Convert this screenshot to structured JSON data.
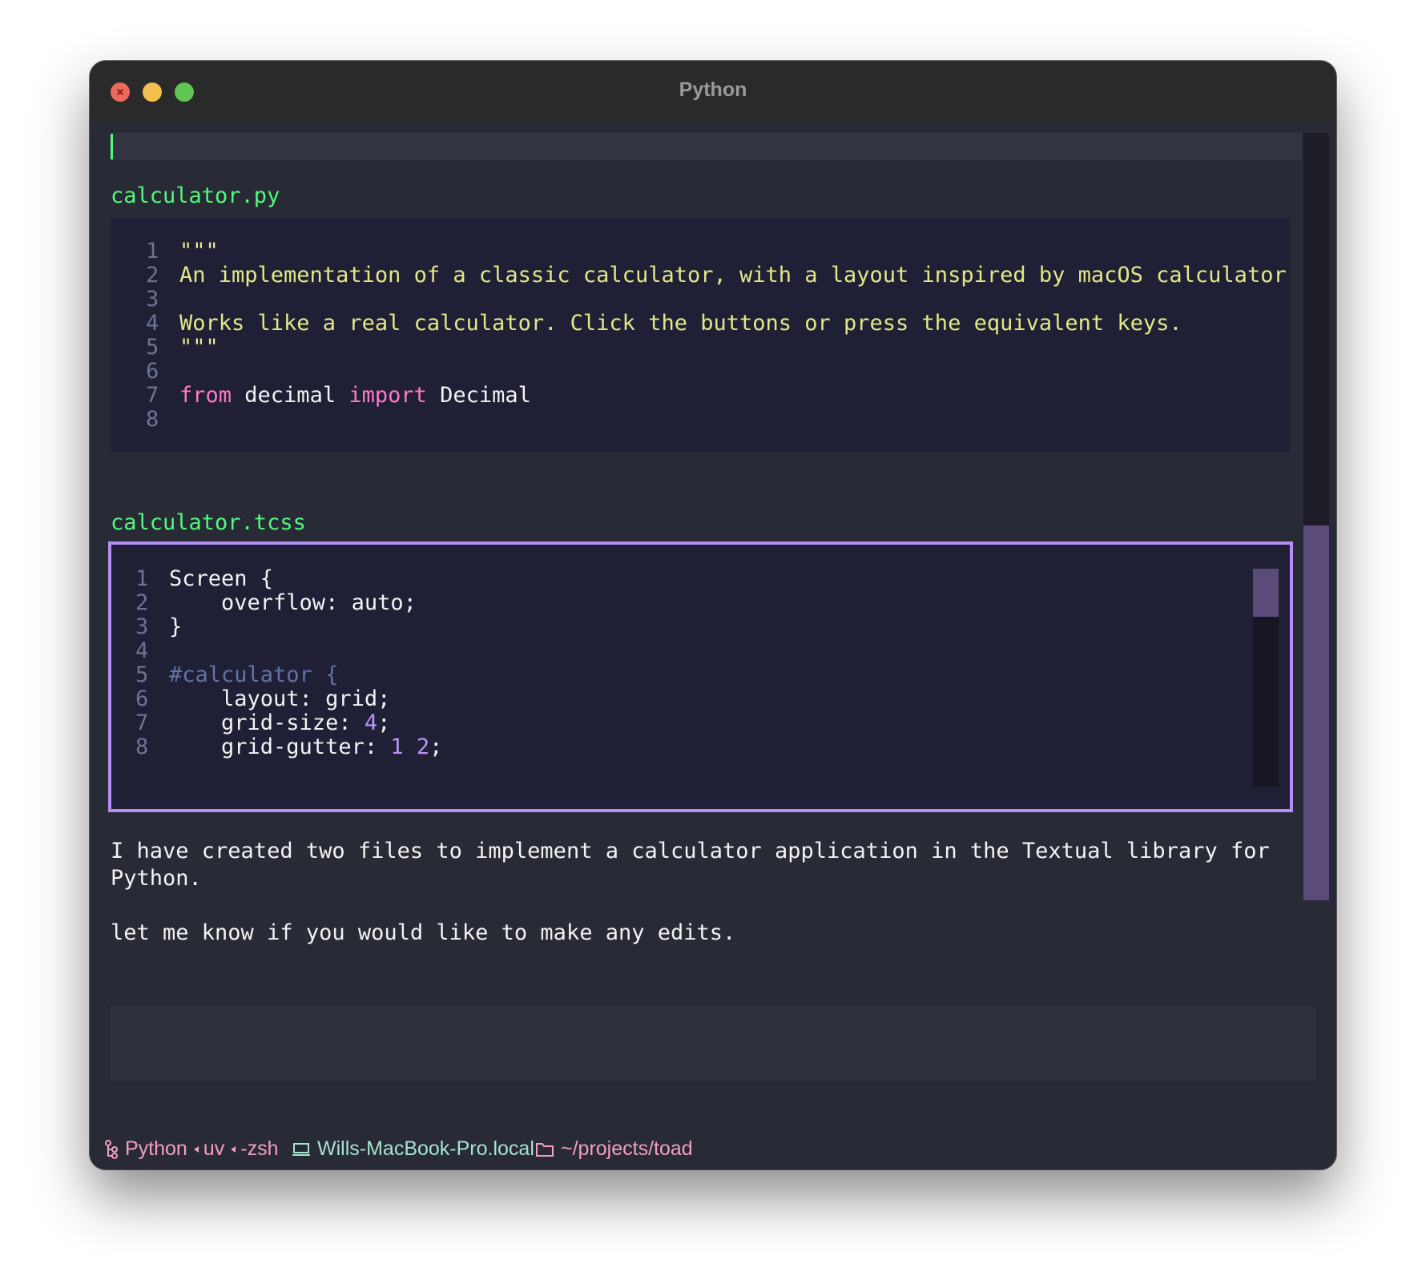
{
  "window": {
    "title": "Python"
  },
  "files": [
    {
      "name": "calculator.py",
      "lines": [
        {
          "n": "1",
          "parts": [
            {
              "t": "\"\"\"",
              "c": "doc"
            }
          ]
        },
        {
          "n": "2",
          "parts": [
            {
              "t": "An implementation of a classic calculator, with a layout inspired by macOS calculator",
              "c": "doc"
            }
          ]
        },
        {
          "n": "3",
          "parts": []
        },
        {
          "n": "4",
          "parts": [
            {
              "t": "Works like a real calculator. Click the buttons or press the equivalent keys.",
              "c": "doc"
            }
          ]
        },
        {
          "n": "5",
          "parts": [
            {
              "t": "\"\"\"",
              "c": "doc"
            }
          ]
        },
        {
          "n": "6",
          "parts": []
        },
        {
          "n": "7",
          "parts": [
            {
              "t": "from",
              "c": "kw"
            },
            {
              "t": " decimal ",
              "c": "plain"
            },
            {
              "t": "import",
              "c": "kw"
            },
            {
              "t": " Decimal",
              "c": "plain"
            }
          ]
        },
        {
          "n": "8",
          "parts": []
        }
      ]
    },
    {
      "name": "calculator.tcss",
      "lines": [
        {
          "n": "1",
          "parts": [
            {
              "t": "Screen {",
              "c": "plain"
            }
          ]
        },
        {
          "n": "2",
          "parts": [
            {
              "t": "    overflow: auto;",
              "c": "plain"
            }
          ]
        },
        {
          "n": "3",
          "parts": [
            {
              "t": "}",
              "c": "plain"
            }
          ]
        },
        {
          "n": "4",
          "parts": []
        },
        {
          "n": "5",
          "parts": [
            {
              "t": "#calculator {",
              "c": "sel"
            }
          ]
        },
        {
          "n": "6",
          "parts": [
            {
              "t": "    layout: grid;",
              "c": "plain"
            }
          ]
        },
        {
          "n": "7",
          "parts": [
            {
              "t": "    grid-size: ",
              "c": "plain"
            },
            {
              "t": "4",
              "c": "num"
            },
            {
              "t": ";",
              "c": "plain"
            }
          ]
        },
        {
          "n": "8",
          "parts": [
            {
              "t": "    grid-gutter: ",
              "c": "plain"
            },
            {
              "t": "1 2",
              "c": "num"
            },
            {
              "t": ";",
              "c": "plain"
            }
          ]
        }
      ]
    }
  ],
  "message": {
    "line1": "I have created two files to implement a calculator application in the Textual library for",
    "line2": "Python.",
    "line3": "let me know if you would like to make any edits."
  },
  "statusbar": {
    "process_a": "Python",
    "process_b": "uv",
    "process_c": "-zsh",
    "host": "Wills-MacBook-Pro.local",
    "path": "~/projects/toad"
  },
  "colors": {
    "filename": "#50fa7b",
    "docstring": "#e4e786",
    "keyword": "#ff79c6",
    "focus_border": "#b48ef5",
    "scrollbar_thumb": "#5b4b7b"
  }
}
